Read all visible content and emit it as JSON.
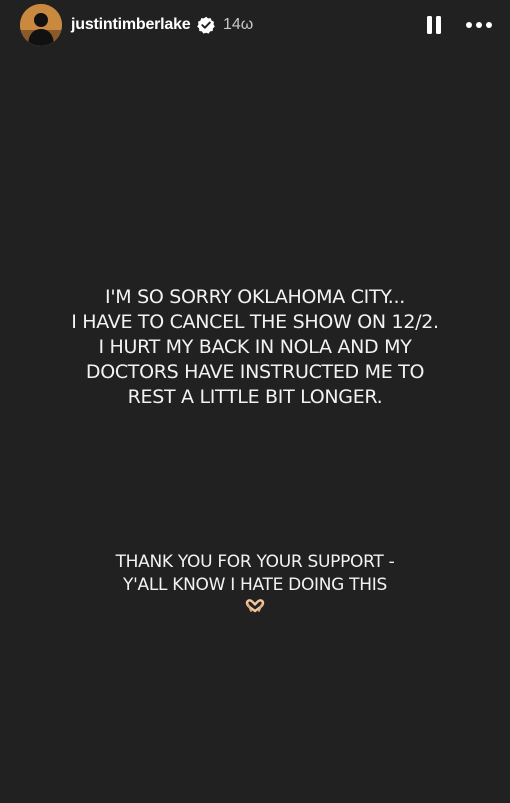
{
  "header": {
    "username": "justintimberlake",
    "verified_icon": "verified-badge-icon",
    "timestamp": "14ω",
    "pause_icon": "pause-icon",
    "more_icon": "more-options-icon"
  },
  "story": {
    "message_lines": [
      "I'M SO SORRY OKLAHOMA CITY...",
      "I HAVE TO CANCEL THE SHOW ON 12/2.",
      "I HURT MY BACK IN NOLA AND MY",
      "DOCTORS HAVE INSTRUCTED ME TO",
      "REST A LITTLE BIT LONGER."
    ],
    "thanks_lines": [
      "THANK YOU FOR YOUR SUPPORT -",
      "Y'ALL KNOW I HATE DOING THIS"
    ],
    "emoji": "heart-hands-emoji"
  },
  "colors": {
    "background": "#212121",
    "text": "#f2f2f2",
    "verified": "#ffffff"
  }
}
